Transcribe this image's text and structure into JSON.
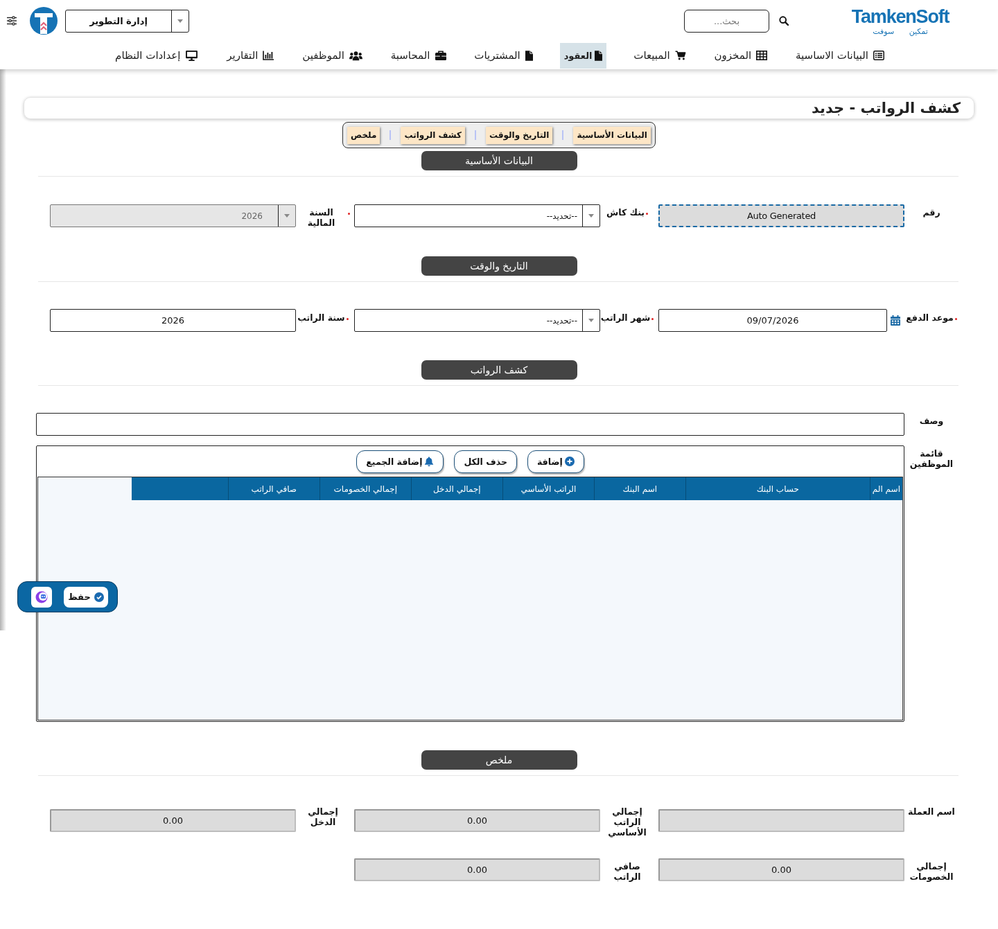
{
  "header": {
    "logo": {
      "wordmark": "TamkenSoft",
      "tagline": "تمكين سوفت"
    },
    "search": {
      "placeholder": "بحث..."
    },
    "department": {
      "value": "إدارة التطوير"
    }
  },
  "nav": [
    {
      "label": "البيانات الاساسية",
      "selected": false
    },
    {
      "label": "المخزون",
      "selected": false
    },
    {
      "label": "المبيعات",
      "selected": false
    },
    {
      "label": "العقود",
      "selected": true
    },
    {
      "label": "المشتريات",
      "selected": false
    },
    {
      "label": "المحاسبة",
      "selected": false
    },
    {
      "label": "الموظفين",
      "selected": false
    },
    {
      "label": "التقارير",
      "selected": false
    },
    {
      "label": "إعدادات النظام",
      "selected": false
    }
  ],
  "page_title": "كشف الرواتب - جديد",
  "section_tabs": [
    {
      "label": "البيانات الأساسية"
    },
    {
      "label": "التاريخ والوقت"
    },
    {
      "label": "كشف الرواتب"
    },
    {
      "label": "ملخص"
    }
  ],
  "sections": [
    {
      "kind": "form",
      "heading": "البيانات الأساسية",
      "rows": [
        [
          {
            "label": "رقم",
            "kind": "auto",
            "value": "Auto Generated",
            "required": false,
            "disabled": false
          },
          {
            "label": "بنك كاش",
            "kind": "select",
            "value": "--تحديد--",
            "required": true,
            "disabled": false
          },
          {
            "label": "السنة المالية",
            "kind": "select",
            "value": "2026",
            "required": true,
            "disabled": true
          }
        ]
      ]
    },
    {
      "kind": "form",
      "heading": "التاريخ والوقت",
      "rows": [
        [
          {
            "label": "موعد الدفع",
            "kind": "date",
            "value": "09/07/2026",
            "required": true,
            "disabled": false
          },
          {
            "label": "شهر الراتب",
            "kind": "select",
            "value": "--تحديد--",
            "required": true,
            "disabled": false
          },
          {
            "label": "سنة الراتب",
            "kind": "text",
            "value": "2026",
            "required": true,
            "disabled": false
          }
        ]
      ]
    },
    {
      "kind": "payroll",
      "heading": "كشف الرواتب",
      "description": {
        "label": "وصف"
      },
      "employees": {
        "label": "قائمة الموظفين",
        "buttons": [
          {
            "label": "إضافة"
          },
          {
            "label": "حذف الكل"
          },
          {
            "label": "إضافة الجميع"
          }
        ],
        "columns": [
          "اسم الم",
          "حساب البنك",
          "اسم البنك",
          "الراتب الأساسي",
          "إجمالي الدخل",
          "إجمالي الخصومات",
          "صافي الراتب"
        ]
      }
    },
    {
      "kind": "form",
      "heading": "ملخص",
      "rows": [
        [
          {
            "label": "اسم العملة",
            "kind": "readonly"
          },
          {
            "label": "إجمالي الراتب الأساسي",
            "kind": "readonly",
            "value": "0.00"
          },
          {
            "label": "إجمالي الدخل",
            "kind": "readonly",
            "value": "0.00"
          }
        ],
        [
          {
            "label": "إجمالي الخصومات",
            "kind": "readonly",
            "value": "0.00"
          },
          {
            "label": "صافي الراتب",
            "kind": "readonly",
            "value": "0.00"
          }
        ]
      ]
    }
  ],
  "save_bar": {
    "save_label": "حفظ"
  }
}
